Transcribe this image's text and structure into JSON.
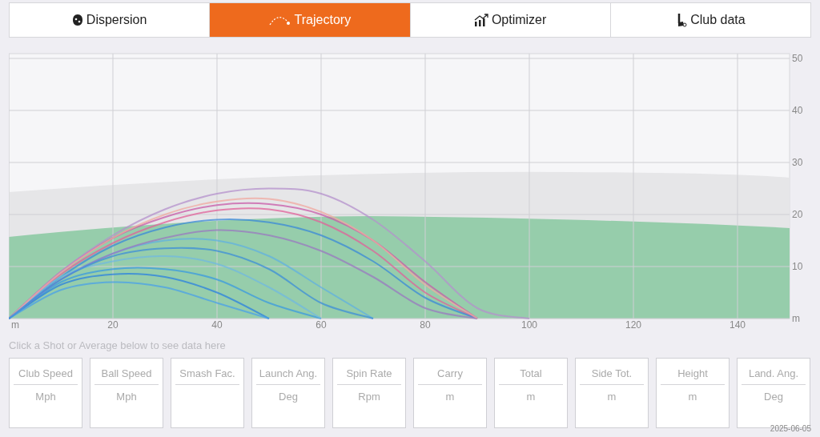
{
  "tabs": [
    {
      "label": "Dispersion",
      "selected": false
    },
    {
      "label": "Trajectory",
      "selected": true
    },
    {
      "label": "Optimizer",
      "selected": false
    },
    {
      "label": "Club data",
      "selected": false
    }
  ],
  "trajectory": {
    "chart_data": {
      "type": "line",
      "grid": true,
      "x": [
        0,
        10,
        20,
        30,
        40,
        50,
        60,
        70,
        80,
        90,
        100
      ],
      "xlim": [
        0,
        150
      ],
      "ylim": [
        0,
        50
      ],
      "xticks": [
        {
          "value": 0,
          "label": "m"
        },
        20,
        40,
        60,
        80,
        100,
        120,
        140
      ],
      "yticks": [
        {
          "value": 0,
          "label": "m"
        },
        10,
        20,
        30,
        40,
        50
      ],
      "series": [
        {
          "color": "#c85aa8",
          "values": [
            0,
            9,
            15.5,
            19.5,
            21.8,
            22,
            20,
            15,
            7,
            0,
            null
          ]
        },
        {
          "color": "#b490cc",
          "values": [
            0,
            9,
            16,
            21,
            24,
            25,
            24,
            19,
            11,
            2,
            0
          ]
        },
        {
          "color": "#e0609a",
          "values": [
            0,
            8.5,
            14.5,
            18.5,
            20.8,
            21,
            18.5,
            13,
            5,
            0,
            null
          ]
        },
        {
          "color": "#3a88d8",
          "values": [
            0,
            8,
            14,
            17.5,
            19,
            18.5,
            16,
            11,
            4,
            0,
            null
          ]
        },
        {
          "color": "#3a9ae0",
          "values": [
            0,
            7,
            9.5,
            9.5,
            7.5,
            3,
            0,
            null,
            null,
            null,
            null
          ]
        },
        {
          "color": "#2a80e0",
          "values": [
            0,
            6.5,
            8.5,
            8,
            5,
            0,
            null,
            null,
            null,
            null,
            null
          ]
        },
        {
          "color": "#60b0e0",
          "values": [
            0,
            7.5,
            12.5,
            15,
            15,
            12,
            6,
            0,
            null,
            null,
            null
          ]
        },
        {
          "color": "#9a78c0",
          "values": [
            0,
            7.5,
            12.5,
            15.5,
            17,
            16,
            13,
            8,
            2,
            0,
            null
          ]
        },
        {
          "color": "#70b8e0",
          "values": [
            0,
            8,
            11,
            12,
            10.5,
            6,
            0,
            null,
            null,
            null,
            null
          ]
        },
        {
          "color": "#f0a8a0",
          "values": [
            0,
            8.8,
            15.5,
            20,
            22.5,
            23,
            20.5,
            15,
            6.5,
            0,
            null
          ]
        },
        {
          "color": "#4aa0e8",
          "values": [
            0,
            5.5,
            7,
            6,
            3,
            0,
            null,
            null,
            null,
            null,
            null
          ]
        },
        {
          "color": "#3c8ed8",
          "values": [
            0,
            7.5,
            12,
            13.5,
            13,
            9.5,
            3,
            0,
            null,
            null,
            null
          ]
        }
      ]
    }
  },
  "hint": "Click a Shot or Average below to see data here",
  "stats": [
    {
      "label": "Club Speed",
      "unit": "Mph"
    },
    {
      "label": "Ball Speed",
      "unit": "Mph"
    },
    {
      "label": "Smash Fac."
    },
    {
      "label": "Launch Ang.",
      "unit": "Deg"
    },
    {
      "label": "Spin Rate",
      "unit": "Rpm"
    },
    {
      "label": "Carry",
      "unit": "m"
    },
    {
      "label": "Total",
      "unit": "m"
    },
    {
      "label": "Side Tot.",
      "unit": "m"
    },
    {
      "label": "Height",
      "unit": "m"
    },
    {
      "label": "Land. Ang.",
      "unit": "Deg"
    }
  ],
  "date": "2025-06-05"
}
